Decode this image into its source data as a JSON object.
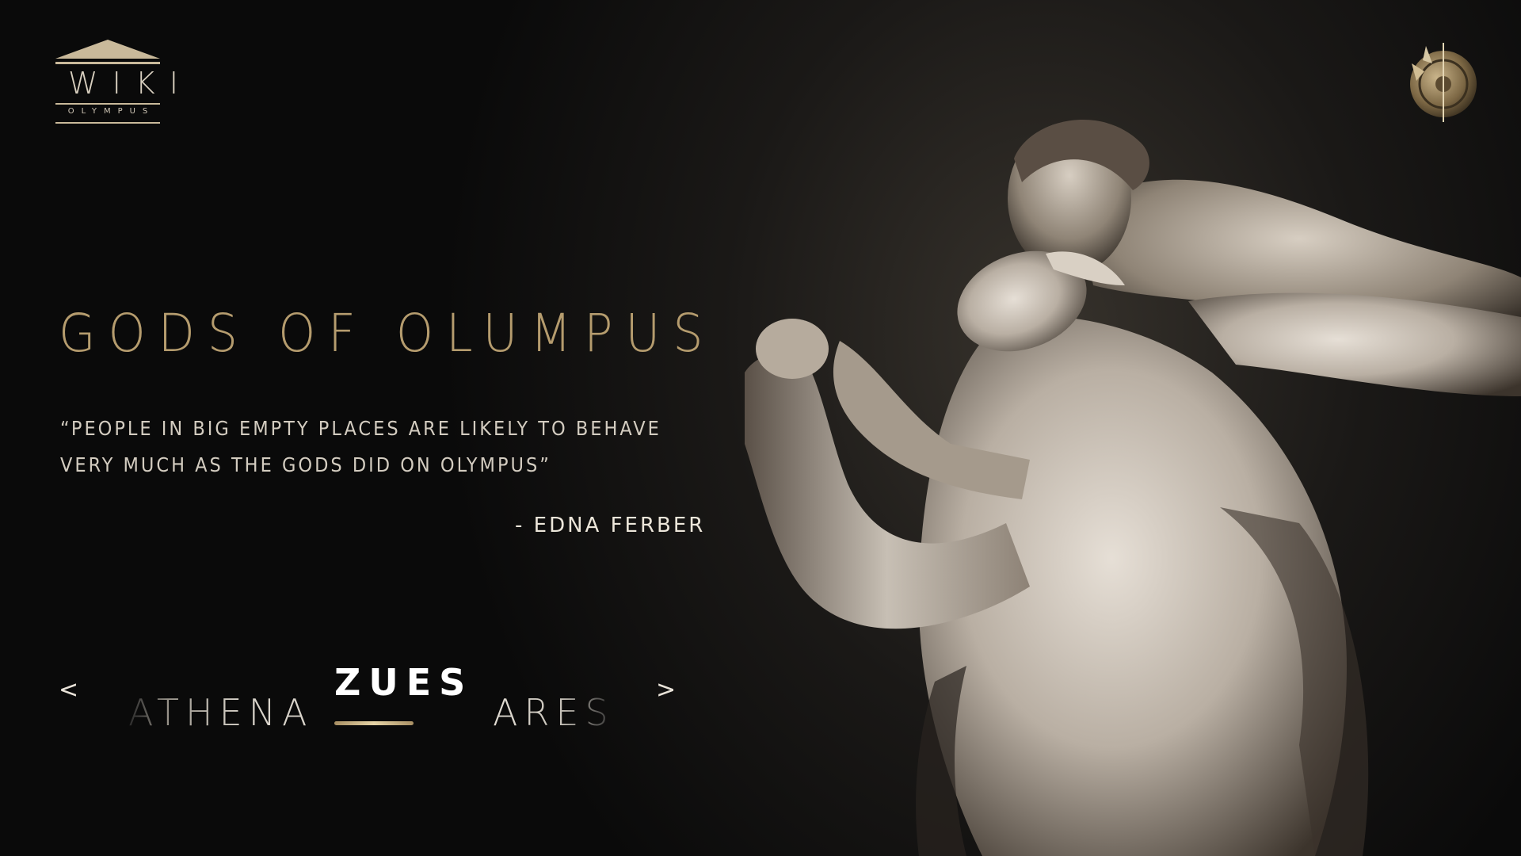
{
  "brand": {
    "logo_word": "WIKI",
    "logo_sub": "OLYMPUS",
    "icon": "temple-icon"
  },
  "header": {
    "menu_icon": "shield-icon"
  },
  "hero": {
    "title": "GODS OF OLUMPUS",
    "quote": "“PEOPLE IN BIG EMPTY PLACES ARE LIKELY TO BEHAVE VERY MUCH AS THE GODS DID ON OLYMPUS”",
    "author": "- EDNA FERBER",
    "image": "marble-statue"
  },
  "carousel": {
    "prev_label": "<",
    "next_label": ">",
    "items": [
      {
        "label": "ATHENA",
        "active": false
      },
      {
        "label": "ZUES",
        "active": true
      },
      {
        "label": "ARES",
        "active": false
      }
    ]
  },
  "colors": {
    "background": "#0b0b0b",
    "accent_gold": "#b59c6e",
    "text": "#e8e2d8"
  }
}
